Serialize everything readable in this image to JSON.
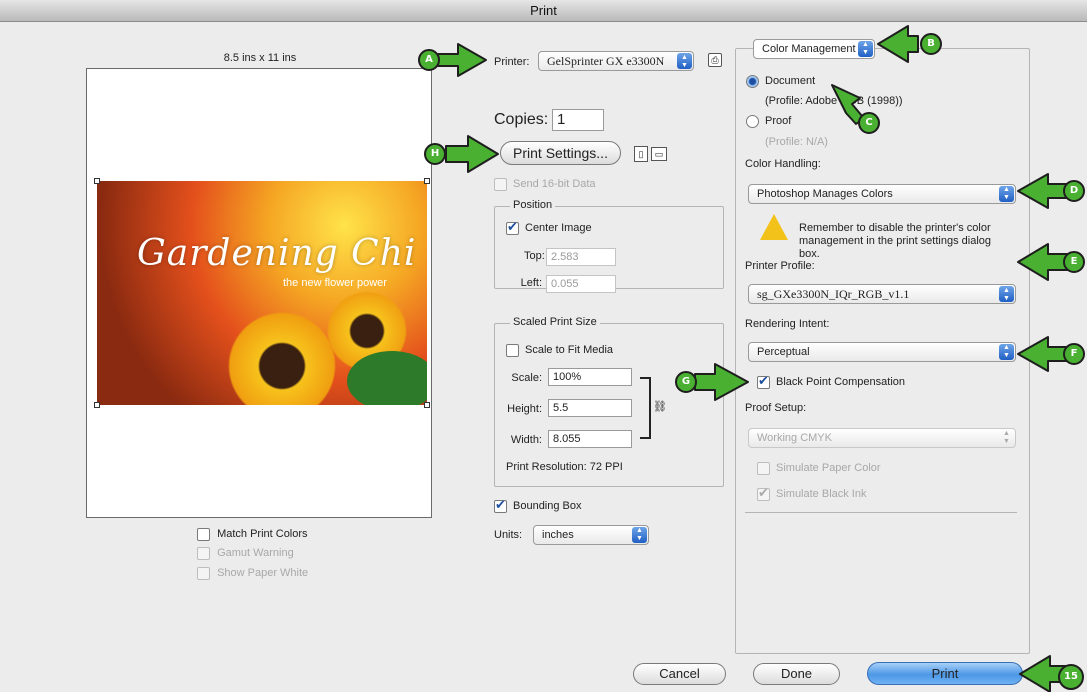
{
  "window": {
    "title": "Print"
  },
  "preview": {
    "paper_size": "8.5 ins x 11 ins",
    "image_title": "Gardening Chi",
    "image_subtitle": "the new flower power"
  },
  "preview_options": [
    {
      "label": "Match Print Colors",
      "checked": false,
      "enabled": true
    },
    {
      "label": "Gamut Warning",
      "checked": false,
      "enabled": false
    },
    {
      "label": "Show Paper White",
      "checked": false,
      "enabled": false
    }
  ],
  "printer": {
    "label": "Printer:",
    "value": "GelSprinter GX e3300N"
  },
  "copies": {
    "label": "Copies:",
    "value": "1"
  },
  "print_settings_button": "Print Settings...",
  "send16bit": {
    "label": "Send 16-bit Data",
    "checked": false,
    "enabled": false
  },
  "position": {
    "legend": "Position",
    "center_label": "Center Image",
    "center_checked": true,
    "top_label": "Top:",
    "top_value": "2.583",
    "left_label": "Left:",
    "left_value": "0.055"
  },
  "scaled": {
    "legend": "Scaled Print Size",
    "fit_label": "Scale to Fit Media",
    "fit_checked": false,
    "scale_label": "Scale:",
    "scale_value": "100%",
    "height_label": "Height:",
    "height_value": "5.5",
    "width_label": "Width:",
    "width_value": "8.055",
    "resolution": "Print Resolution: 72 PPI"
  },
  "bounding_box": {
    "label": "Bounding Box",
    "checked": true
  },
  "units": {
    "label": "Units:",
    "value": "inches"
  },
  "color_mgmt": {
    "section": "Color Management",
    "document_label": "Document",
    "document_profile": "(Profile: Adobe RGB (1998))",
    "document_selected": true,
    "proof_label": "Proof",
    "proof_profile": "(Profile: N/A)",
    "proof_selected": false,
    "handling_label": "Color Handling:",
    "handling_value": "Photoshop Manages Colors",
    "warning_text": "Remember to disable the printer's color management in the print settings dialog box.",
    "profile_label": "Printer Profile:",
    "profile_value": "sg_GXe3300N_IQr_RGB_v1.1",
    "intent_label": "Rendering Intent:",
    "intent_value": "Perceptual",
    "bpc_label": "Black Point Compensation",
    "bpc_checked": true,
    "proof_setup_label": "Proof Setup:",
    "proof_setup_value": "Working CMYK",
    "sim_paper_label": "Simulate Paper Color",
    "sim_paper_checked": false,
    "sim_ink_label": "Simulate Black Ink",
    "sim_ink_checked": true
  },
  "buttons": {
    "cancel": "Cancel",
    "done": "Done",
    "print": "Print"
  },
  "callouts": {
    "a": "A",
    "b": "B",
    "c": "C",
    "d": "D",
    "e": "E",
    "f": "F",
    "g": "G",
    "h": "H",
    "step": "15"
  },
  "colors": {
    "callout_green": "#49b032",
    "accent_blue": "#2060c4"
  }
}
